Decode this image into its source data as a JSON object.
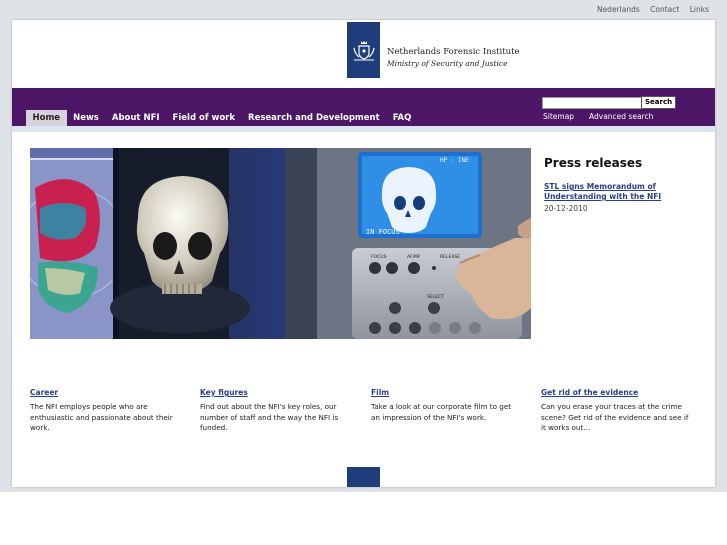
{
  "top_links": [
    "Nederlands",
    "Contact",
    "Links"
  ],
  "logo": {
    "line1": "Netherlands Forensic Institute",
    "line2": "Ministry of Security and Justice"
  },
  "search": {
    "placeholder": "",
    "button": "Search"
  },
  "util_links": {
    "sitemap": "Sitemap",
    "advanced": "Advanced search"
  },
  "nav": [
    {
      "label": "Home",
      "active": true
    },
    {
      "label": "News"
    },
    {
      "label": "About NFI"
    },
    {
      "label": "Field of work"
    },
    {
      "label": "Research and Development"
    },
    {
      "label": "FAQ"
    }
  ],
  "press": {
    "heading": "Press releases",
    "item_title": "STL signs Memorandum of Understanding with the NFI",
    "item_date": "20-12-2010"
  },
  "teasers": [
    {
      "title": "Career",
      "text": "The NFI employs people who are enthusiastic and passionate about their work."
    },
    {
      "title": "Key figures",
      "text": "Find out about the NFI's key roles, our number of staff and the way the NFI is funded."
    },
    {
      "title": "Film",
      "text": "Take a look at our corporate film to get an impression of the NFI's work."
    },
    {
      "title": "Get rid of the evidence",
      "text": "Can you erase your traces at the crime scene? Get rid of the evidence and see if it works out..."
    }
  ],
  "hero": {
    "monitor_label": "IN FOCUS",
    "panel_label": "HP · INE",
    "buttons": [
      "FOCUS",
      "AF/MF",
      "RELEASE",
      "SELECT"
    ]
  },
  "colors": {
    "nav_bg": "#4d1566",
    "brand_blue": "#1f3d7a",
    "link": "#2a3f8a"
  }
}
